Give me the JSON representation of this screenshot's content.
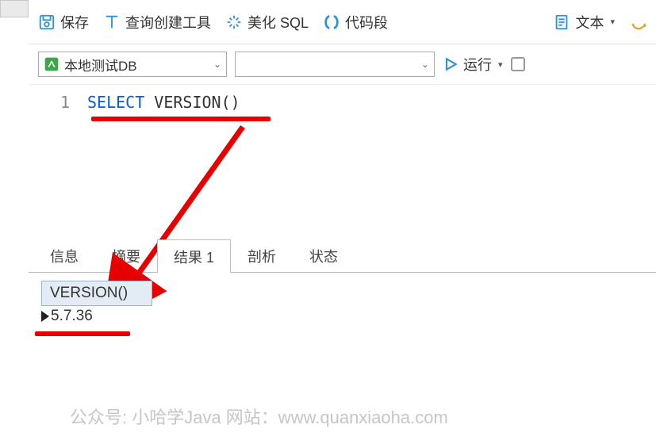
{
  "toolbar": {
    "save": "保存",
    "query_builder": "查询创建工具",
    "beautify": "美化 SQL",
    "snippets": "代码段",
    "text": "文本"
  },
  "second_row": {
    "db_name": "本地测试DB",
    "run": "运行"
  },
  "editor": {
    "line_number": "1",
    "keyword": "SELECT",
    "func": "VERSION()"
  },
  "tabs": {
    "info": "信息",
    "summary": "摘要",
    "result": "结果 1",
    "profile": "剖析",
    "status": "状态"
  },
  "result": {
    "header": "VERSION()",
    "value": "5.7.36"
  },
  "watermark": "公众号: 小哈学Java  网站：www.quanxiaoha.com"
}
